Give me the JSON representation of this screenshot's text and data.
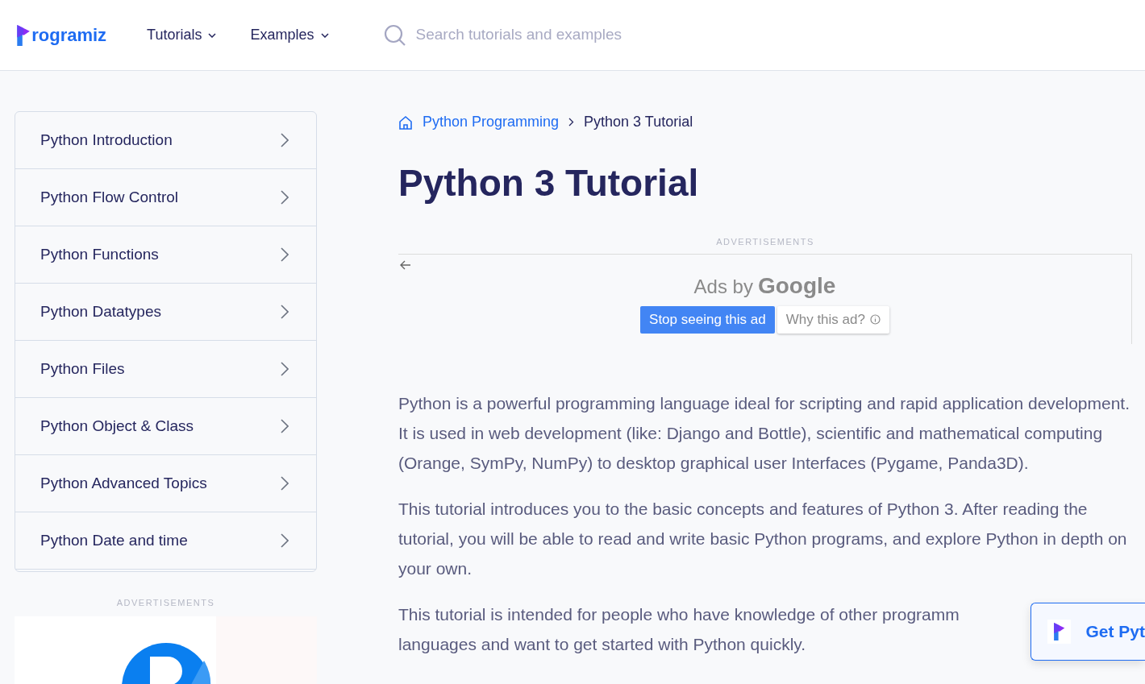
{
  "header": {
    "logo": "rogramiz",
    "nav": [
      {
        "label": "Tutorials"
      },
      {
        "label": "Examples"
      }
    ],
    "search": {
      "placeholder": "Search tutorials and examples"
    }
  },
  "sidebar": {
    "items": [
      {
        "label": "Python Introduction"
      },
      {
        "label": "Python Flow Control"
      },
      {
        "label": "Python Functions"
      },
      {
        "label": "Python Datatypes"
      },
      {
        "label": "Python Files"
      },
      {
        "label": "Python Object & Class"
      },
      {
        "label": "Python Advanced Topics"
      },
      {
        "label": "Python Date and time"
      }
    ],
    "ad_label": "ADVERTISEMENTS"
  },
  "breadcrumb": [
    {
      "label": "Python Programming",
      "link": true
    },
    {
      "label": "Python 3 Tutorial",
      "link": false
    }
  ],
  "title": "Python 3 Tutorial",
  "ad": {
    "label": "ADVERTISEMENTS",
    "ads_by": "Ads by",
    "google": "Google",
    "stop_button": "Stop seeing this ad",
    "why_button": "Why this ad?"
  },
  "paragraphs": [
    "Python is a powerful programming language ideal for scripting and rapid application development. It is used in web development (like: Django and Bottle), scientific and mathematical computing (Orange, SymPy, NumPy) to desktop graphical user Interfaces (Pygame, Panda3D).",
    "This tutorial introduces you to the basic concepts and features of Python 3. After reading the tutorial, you will be able to read and write basic Python programs, and explore Python in depth on your own."
  ],
  "last_paragraph_lines": [
    "This tutorial is intended for people who have knowledge of other programm",
    "languages and want to get started with Python quickly."
  ],
  "floating_button": {
    "label": "Get Pyt"
  }
}
